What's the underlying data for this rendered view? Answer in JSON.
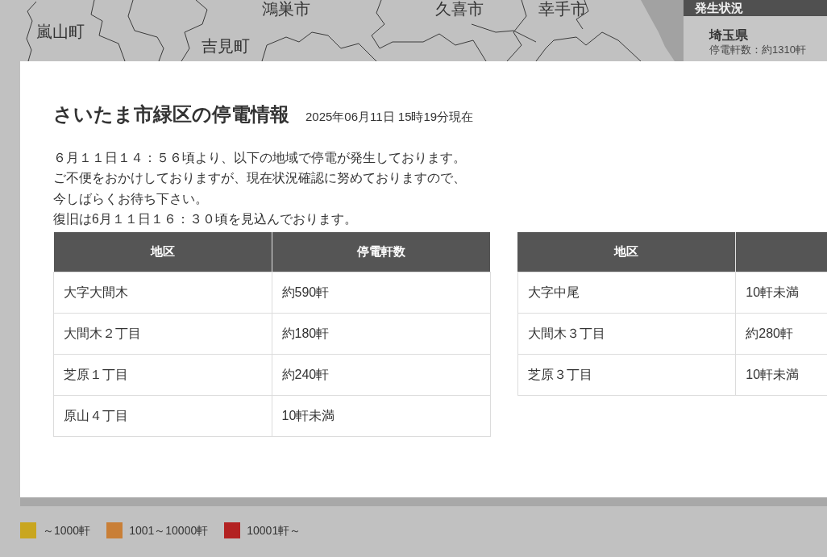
{
  "map": {
    "place_labels": [
      "嵐山町",
      "吉見町",
      "鴻巣市",
      "久喜市",
      "幸手市"
    ]
  },
  "status_panel": {
    "title": "発生状況",
    "prefecture": "埼玉県",
    "outage_count": "停電軒数：約1310軒"
  },
  "dialog": {
    "title": "さいたま市緑区の停電情報",
    "timestamp": "2025年06月11日 15時19分現在",
    "notice_lines": [
      "６月１１日１４：５６頃より、以下の地域で停電が発生しております。",
      "ご不便をおかけしておりますが、現在状況確認に努めておりますので、",
      "今しばらくお待ち下さい。",
      "復旧は6月１１日１６：３０頃を見込んでおります。"
    ],
    "tables": [
      {
        "columns": [
          "地区",
          "停電軒数"
        ],
        "rows": [
          [
            "大字大間木",
            "約590軒"
          ],
          [
            "大間木２丁目",
            "約180軒"
          ],
          [
            "芝原１丁目",
            "約240軒"
          ],
          [
            "原山４丁目",
            "10軒未満"
          ]
        ]
      },
      {
        "columns": [
          "地区"
        ],
        "rows": [
          [
            "大字中尾",
            "10軒未満"
          ],
          [
            "大間木３丁目",
            "約280軒"
          ],
          [
            "芝原３丁目",
            "10軒未満"
          ]
        ]
      }
    ]
  },
  "legend": [
    {
      "label": "～1000軒",
      "color": "#c9a61f"
    },
    {
      "label": "1001～10000軒",
      "color": "#c97f37"
    },
    {
      "label": "10001軒～",
      "color": "#b32222"
    }
  ]
}
